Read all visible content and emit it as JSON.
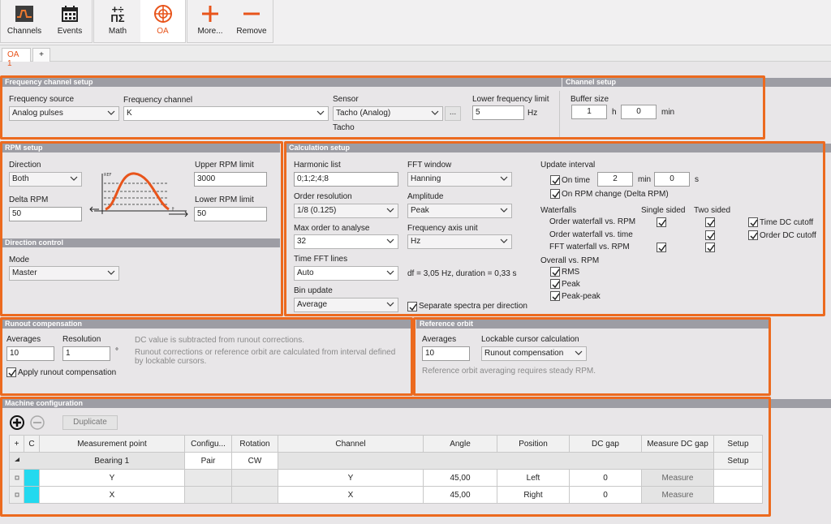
{
  "toolbar": {
    "buttons": [
      {
        "label": "Channels",
        "icon": "channels-icon"
      },
      {
        "label": "Events",
        "icon": "events-icon"
      },
      {
        "label": "Math",
        "icon": "math-icon"
      },
      {
        "label": "OA",
        "icon": "oa-icon"
      },
      {
        "label": "More...",
        "icon": "plus-icon"
      },
      {
        "label": "Remove",
        "icon": "minus-icon"
      }
    ],
    "accent": "#e8541b"
  },
  "tabs": {
    "items": [
      "OA 1"
    ],
    "add": "+"
  },
  "freq": {
    "title": "Frequency channel setup",
    "source_label": "Frequency source",
    "source_value": "Analog pulses",
    "channel_label": "Frequency channel",
    "channel_value": "K",
    "sensor_label": "Sensor",
    "sensor_value": "Tacho (Analog)",
    "sensor_btn": "...",
    "sensor_sub": "Tacho",
    "lower_label": "Lower frequency limit",
    "lower_value": "5",
    "lower_unit": "Hz"
  },
  "channel_setup": {
    "title": "Channel setup",
    "buffer_label": "Buffer size",
    "hours": "1",
    "hours_unit": "h",
    "mins": "0",
    "mins_unit": "min"
  },
  "rpm": {
    "title": "RPM setup",
    "direction_label": "Direction",
    "direction_value": "Both",
    "delta_label": "Delta RPM",
    "delta_value": "50",
    "upper_label": "Upper RPM limit",
    "upper_value": "3000",
    "lower_label": "Lower RPM limit",
    "lower_value": "50",
    "graph_ref": "REF",
    "graph_t": "t"
  },
  "direction_control": {
    "title": "Direction control",
    "mode_label": "Mode",
    "mode_value": "Master"
  },
  "calc": {
    "title": "Calculation setup",
    "harmonic_label": "Harmonic list",
    "harmonic_value": "0;1;2;4;8",
    "order_res_label": "Order resolution",
    "order_res_value": "1/8 (0.125)",
    "max_order_label": "Max order to analyse",
    "max_order_value": "32",
    "fft_lines_label": "Time FFT lines",
    "fft_lines_value": "Auto",
    "bin_label": "Bin update",
    "bin_value": "Average",
    "window_label": "FFT window",
    "window_value": "Hanning",
    "amplitude_label": "Amplitude",
    "amplitude_value": "Peak",
    "axis_unit_label": "Frequency axis unit",
    "axis_unit_value": "Hz",
    "df_text": "df = 3,05 Hz, duration = 0,33 s",
    "separate_label": "Separate spectra per direction",
    "update_label": "Update interval",
    "on_time_label": "On time",
    "on_time_min": "2",
    "min_unit": "min",
    "on_time_s": "0",
    "s_unit": "s",
    "on_rpm_label": "On RPM change (Delta RPM)",
    "waterfalls_label": "Waterfalls",
    "single_label": "Single sided",
    "two_label": "Two sided",
    "wf_rows": [
      "Order waterfall vs. RPM",
      "Order waterfall vs. time",
      "FFT waterfall vs. RPM"
    ],
    "time_dc_label": "Time DC cutoff",
    "order_dc_label": "Order DC cutoff",
    "overall_label": "Overall vs. RPM",
    "overall_items": [
      "RMS",
      "Peak",
      "Peak-peak"
    ]
  },
  "runout": {
    "title": "Runout compensation",
    "avg_label": "Averages",
    "avg_value": "10",
    "res_label": "Resolution",
    "res_value": "1",
    "res_unit": "°",
    "apply_label": "Apply runout compensation",
    "hint1": "DC value is subtracted from runout corrections.",
    "hint2": "Runout corrections or reference orbit are calculated from interval defined",
    "hint3": "by lockable cursors."
  },
  "ref_orbit": {
    "title": "Reference orbit",
    "avg_label": "Averages",
    "avg_value": "10",
    "cursor_label": "Lockable cursor calculation",
    "cursor_value": "Runout compensation",
    "hint": "Reference orbit averaging requires steady RPM."
  },
  "machine": {
    "title": "Machine configuration",
    "duplicate": "Duplicate",
    "headers": [
      "+",
      "C",
      "Measurement point",
      "Configu...",
      "Rotation",
      "Channel",
      "Angle",
      "Position",
      "DC gap",
      "Measure DC gap",
      "Setup"
    ],
    "group": {
      "name": "Bearing 1",
      "config": "Pair",
      "rotation": "CW",
      "setup": "Setup"
    },
    "rows": [
      {
        "point": "Y",
        "channel": "Y",
        "angle": "45,00",
        "position": "Left",
        "dcgap": "0",
        "measure": "Measure"
      },
      {
        "point": "X",
        "channel": "X",
        "angle": "45,00",
        "position": "Right",
        "dcgap": "0",
        "measure": "Measure"
      }
    ]
  }
}
